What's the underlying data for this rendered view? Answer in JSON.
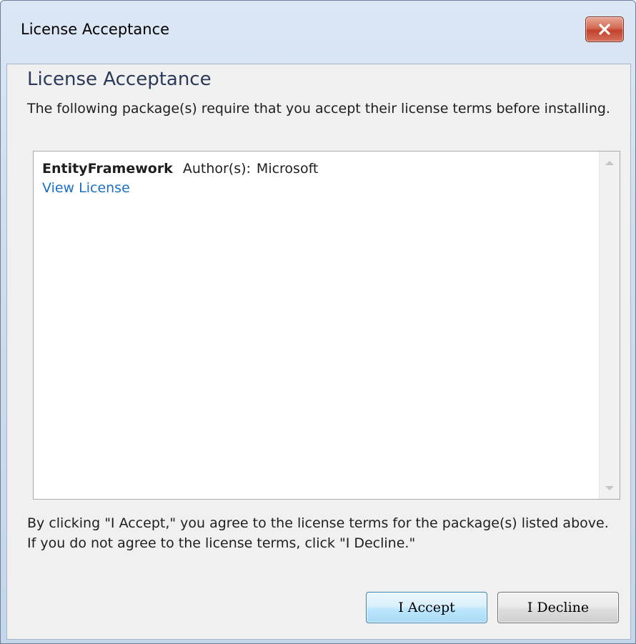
{
  "window": {
    "title": "License Acceptance",
    "close_icon": "close-icon"
  },
  "dialog": {
    "heading": "License Acceptance",
    "intro": "The following package(s) require that you accept their license terms before installing.",
    "packages": [
      {
        "name": "EntityFramework",
        "author_label": "Author(s):",
        "author": "Microsoft",
        "link_label": "View License"
      }
    ],
    "terms": "By clicking \"I Accept,\" you agree to the license terms for the package(s) listed above. If you do not agree to the license terms, click \"I Decline.\"",
    "buttons": {
      "accept": "I Accept",
      "decline": "I Decline"
    }
  },
  "colors": {
    "link": "#1a6fc6",
    "heading": "#2b3a59",
    "close_button": "#c2412b"
  }
}
